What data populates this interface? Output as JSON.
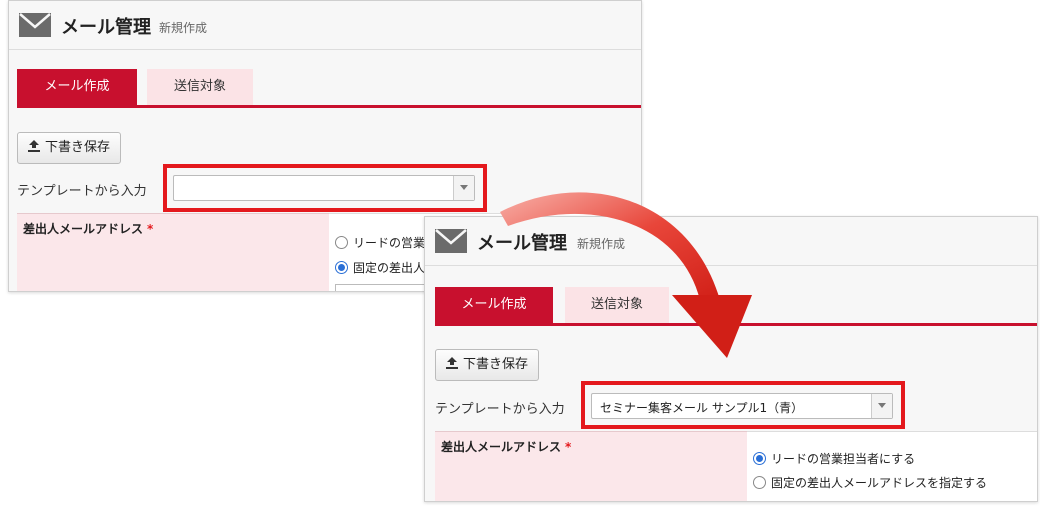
{
  "before": {
    "header": {
      "title": "メール管理",
      "subtitle": "新規作成"
    },
    "tabs": [
      {
        "label": "メール作成",
        "active": true
      },
      {
        "label": "送信対象",
        "active": false
      }
    ],
    "save_button": "下書き保存",
    "template_label": "テンプレートから入力",
    "template_value": "",
    "sender": {
      "label": "差出人メールアドレス",
      "required_mark": "*",
      "options": [
        {
          "label": "リードの営業",
          "selected": false
        },
        {
          "label": "固定の差出人",
          "selected": true
        }
      ]
    }
  },
  "after": {
    "header": {
      "title": "メール管理",
      "subtitle": "新規作成"
    },
    "tabs": [
      {
        "label": "メール作成",
        "active": true
      },
      {
        "label": "送信対象",
        "active": false
      }
    ],
    "save_button": "下書き保存",
    "template_label": "テンプレートから入力",
    "template_value": "セミナー集客メール サンプル1（青）",
    "sender": {
      "label": "差出人メールアドレス",
      "required_mark": "*",
      "options": [
        {
          "label": "リードの営業担当者にする",
          "selected": true
        },
        {
          "label": "固定の差出人メールアドレスを指定する",
          "selected": false
        }
      ]
    }
  },
  "colors": {
    "brand_red": "#c8102e",
    "highlight": "#e4191d",
    "tab_inactive": "#fbe3e6",
    "radio_selected": "#2a6fd6"
  },
  "icons": {
    "mail": "mail-icon",
    "upload": "upload-icon",
    "dropdown": "chevron-down-icon",
    "arrow": "curved-arrow-icon"
  }
}
